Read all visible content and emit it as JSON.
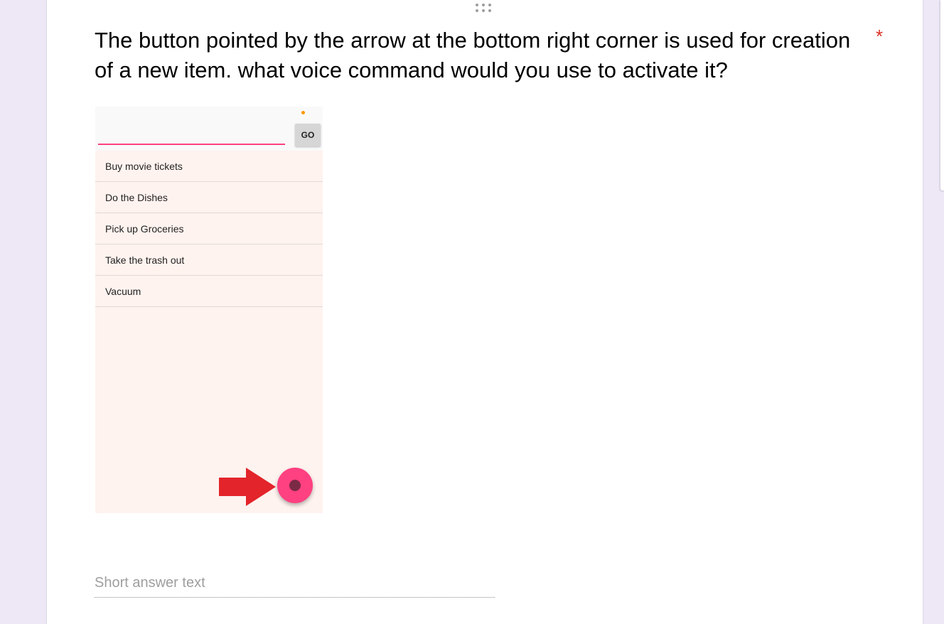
{
  "question": {
    "text": "The button pointed by the arrow at the bottom right corner is used for creation of a new item. what voice command would you use to activate it?",
    "required_marker": "*"
  },
  "image": {
    "go_button_label": "GO",
    "todo_items": [
      "Buy movie tickets",
      "Do the Dishes",
      "Pick up Groceries",
      "Take the trash out",
      "Vacuum"
    ]
  },
  "answer": {
    "placeholder": "Short answer text"
  },
  "colors": {
    "background": "#ede7f6",
    "required": "#d93025",
    "accent": "#ff4081",
    "arrow": "#e3242b",
    "list_background": "#fff3ef"
  },
  "icons": [
    "drag-handle-icon",
    "red-arrow-icon"
  ]
}
